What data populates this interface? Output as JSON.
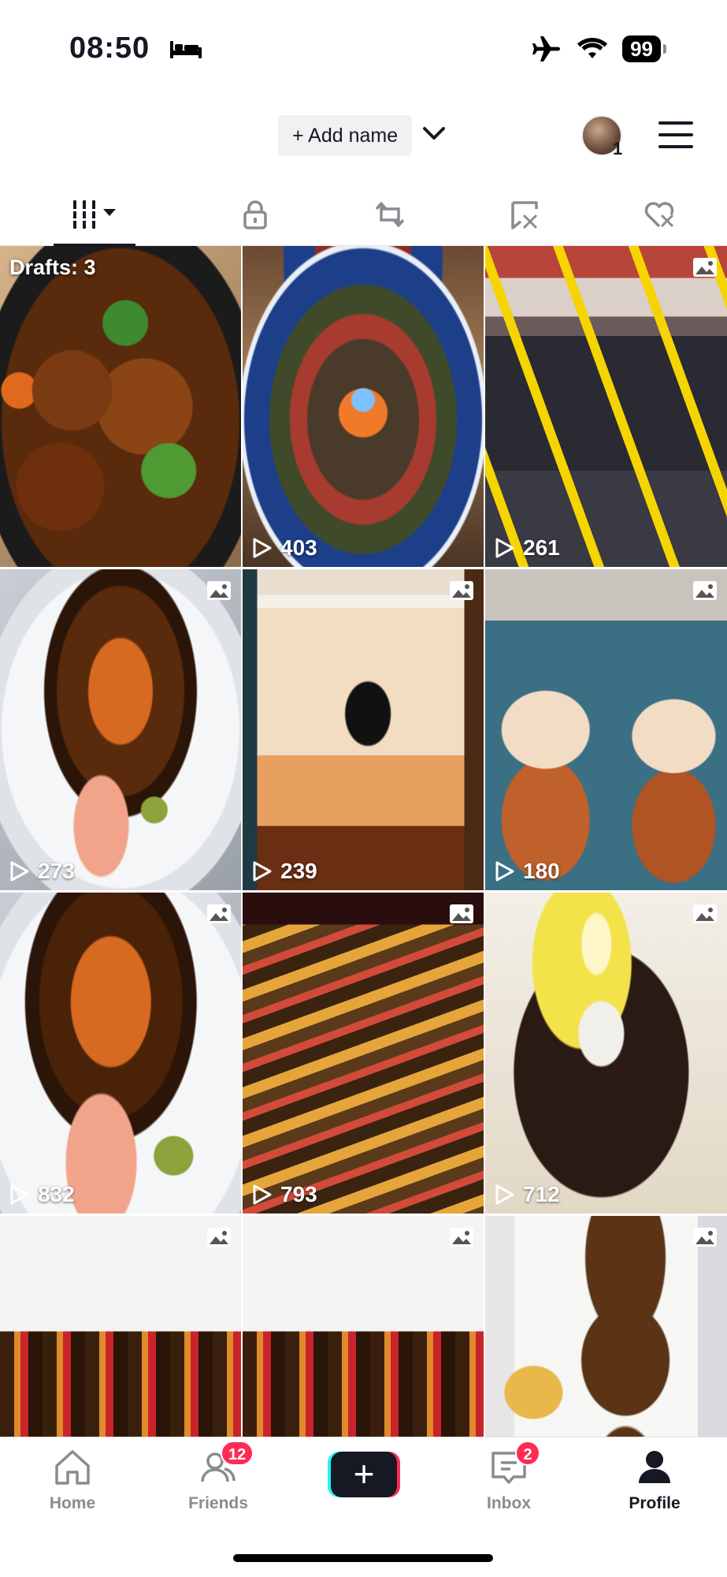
{
  "status_bar": {
    "time": "08:50",
    "battery": "99",
    "icons": [
      "bed-icon",
      "airplane-icon",
      "wifi-icon",
      "battery-icon"
    ]
  },
  "header": {
    "add_name_label": "+ Add name",
    "avatar_badge": "1"
  },
  "tabs": [
    {
      "name": "videos",
      "icon": "grid-icon"
    },
    {
      "name": "private",
      "icon": "lock-icon"
    },
    {
      "name": "reposts",
      "icon": "repost-icon"
    },
    {
      "name": "favorites",
      "icon": "bookmark-icon"
    },
    {
      "name": "liked",
      "icon": "heart-icon"
    }
  ],
  "grid": {
    "drafts_label": "Drafts: 3",
    "items": [
      {
        "views": "",
        "type": "drafts",
        "subject": "teriyaki chicken bowl"
      },
      {
        "views": "403",
        "type": "video",
        "subject": "sushi platter"
      },
      {
        "views": "261",
        "type": "photo",
        "subject": "airport luggage"
      },
      {
        "views": "273",
        "type": "photo",
        "subject": "sushi roll plate"
      },
      {
        "views": "239",
        "type": "photo",
        "subject": "milk tea cup"
      },
      {
        "views": "180",
        "type": "photo",
        "subject": "two milk teas"
      },
      {
        "views": "832",
        "type": "photo",
        "subject": "sushi roll plate"
      },
      {
        "views": "793",
        "type": "photo",
        "subject": "sushi rolls board"
      },
      {
        "views": "712",
        "type": "photo",
        "subject": "dessert cups"
      },
      {
        "views": "",
        "type": "photo",
        "subject": "sushi takeout"
      },
      {
        "views": "",
        "type": "photo",
        "subject": "sushi takeout"
      },
      {
        "views": "",
        "type": "photo",
        "subject": "takeout boxes"
      }
    ]
  },
  "bottom_nav": {
    "home": "Home",
    "friends": "Friends",
    "friends_badge": "12",
    "create": "+",
    "inbox": "Inbox",
    "inbox_badge": "2",
    "profile": "Profile"
  },
  "colors": {
    "accent": "#fe2c55",
    "create_cyan": "#25f4ee",
    "text": "#161823",
    "muted": "#8a8b91"
  }
}
